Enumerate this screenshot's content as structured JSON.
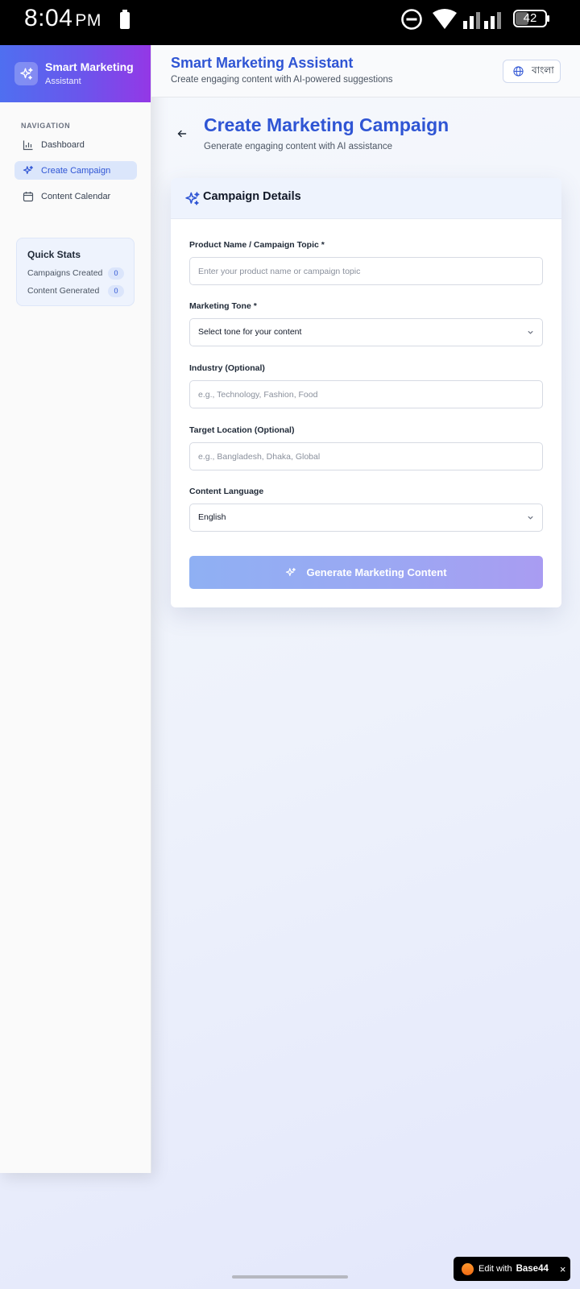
{
  "status_bar": {
    "time": "8:04",
    "ampm": "PM",
    "battery_level": "42"
  },
  "sidebar": {
    "brand_title": "Smart Marketing",
    "brand_subtitle": "Assistant",
    "nav_heading": "NAVIGATION",
    "items": [
      {
        "label": "Dashboard",
        "icon": "bar-chart-icon",
        "active": false
      },
      {
        "label": "Create Campaign",
        "icon": "sparkles-icon",
        "active": true
      },
      {
        "label": "Content Calendar",
        "icon": "calendar-icon",
        "active": false
      }
    ],
    "quick_stats": {
      "title": "Quick Stats",
      "rows": [
        {
          "label": "Campaigns Created",
          "value": "0"
        },
        {
          "label": "Content Generated",
          "value": "0"
        }
      ]
    }
  },
  "header": {
    "title": "Smart Marketing Assistant",
    "subtitle": "Create engaging content with AI-powered suggestions",
    "language_button": "বাংলা"
  },
  "page": {
    "title": "Create Marketing Campaign",
    "subtitle": "Generate engaging content with AI assistance"
  },
  "card": {
    "title": "Campaign Details",
    "fields": {
      "product": {
        "label": "Product Name / Campaign Topic *",
        "value": "",
        "placeholder": "Enter your product name or campaign topic"
      },
      "tone": {
        "label": "Marketing Tone *",
        "value": "Select tone for your content"
      },
      "industry": {
        "label": "Industry (Optional)",
        "value": "",
        "placeholder": "e.g., Technology, Fashion, Food"
      },
      "location": {
        "label": "Target Location (Optional)",
        "value": "",
        "placeholder": "e.g., Bangladesh, Dhaka, Global"
      },
      "language": {
        "label": "Content Language",
        "value": "English"
      }
    },
    "generate_button": "Generate Marketing Content"
  },
  "footer": {
    "edit_with": "Edit with",
    "brand": "Base44",
    "close": "×"
  },
  "colors": {
    "accent": "#2f55d4",
    "brand_gradient_start": "#4f6ff0",
    "brand_gradient_end": "#9438e6",
    "button_disabled_start": "#8fb0f3",
    "button_disabled_end": "#a99cf2"
  }
}
